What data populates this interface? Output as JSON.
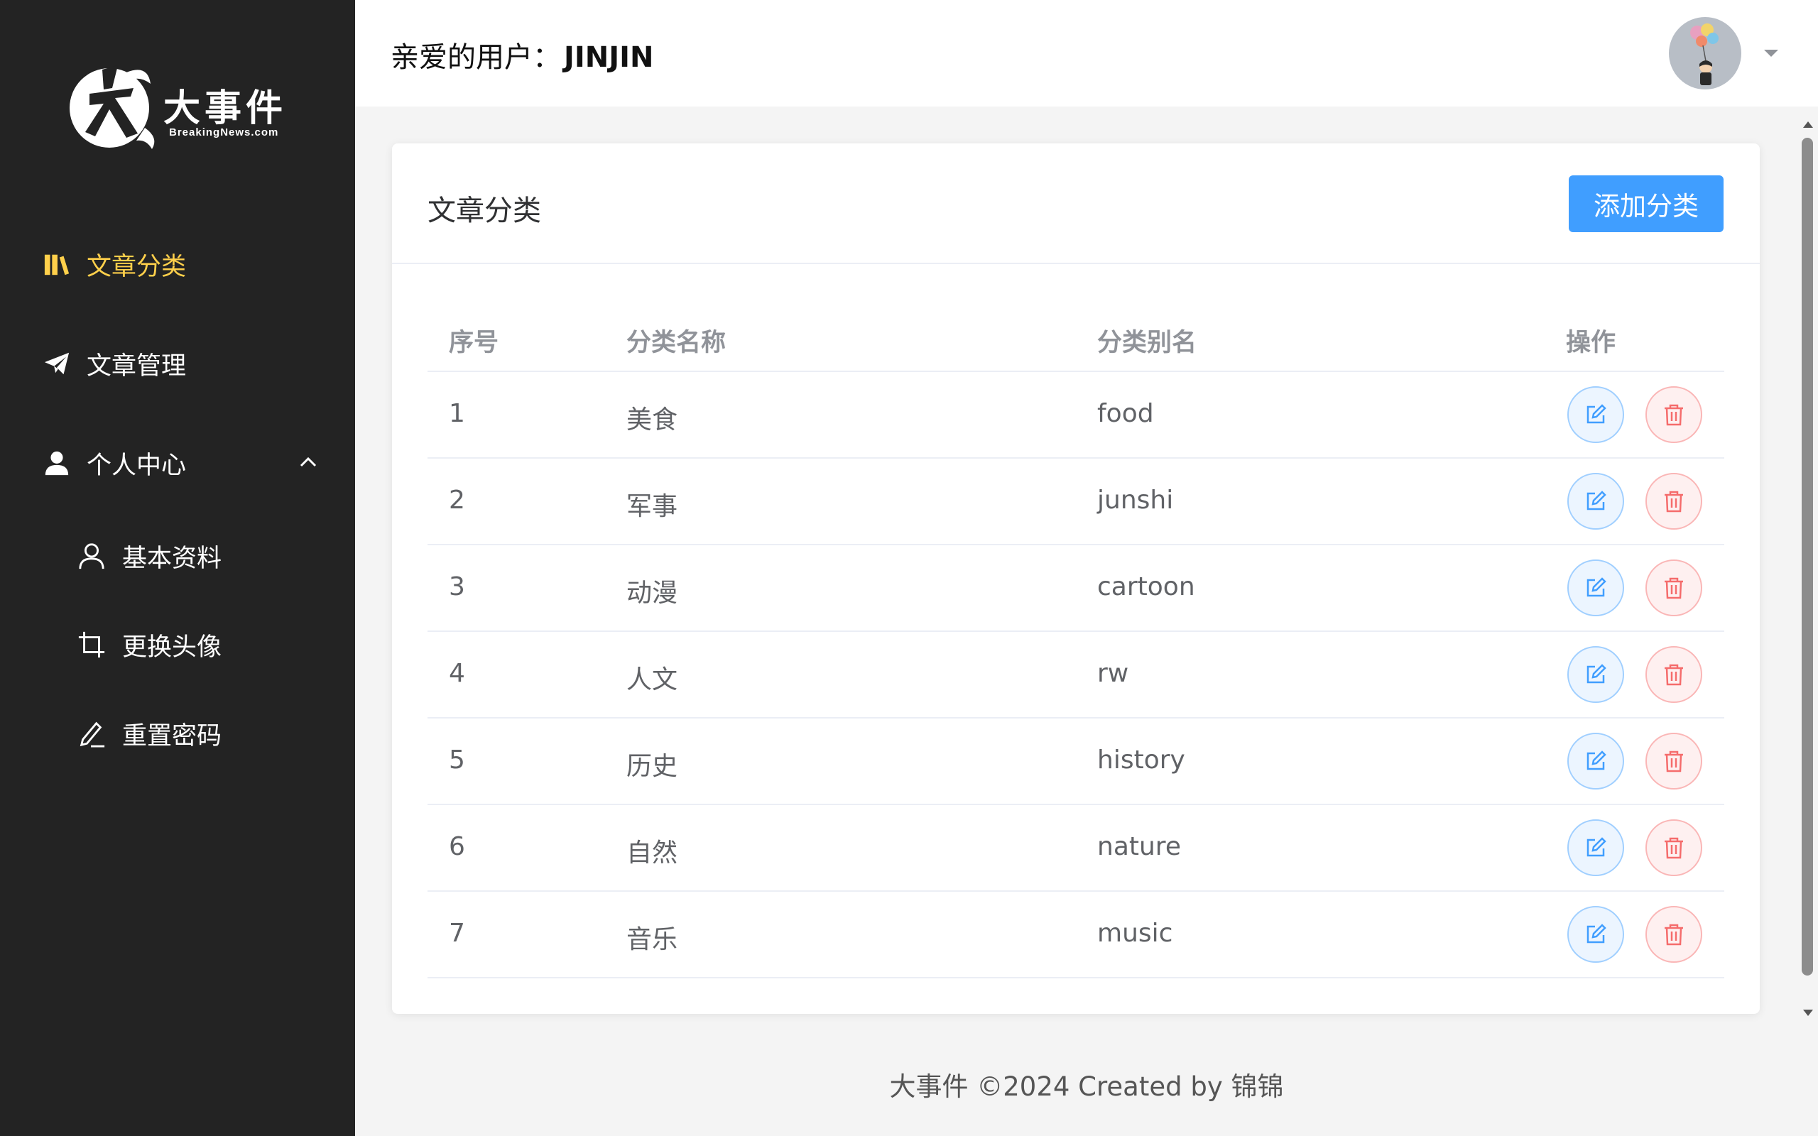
{
  "brand": {
    "name_cn": "大事件",
    "name_en": "BreakingNews.com"
  },
  "sidebar": {
    "items": [
      {
        "label": "文章分类",
        "icon": "bookshelf-icon",
        "active": true
      },
      {
        "label": "文章管理",
        "icon": "paper-plane-icon",
        "active": false
      },
      {
        "label": "个人中心",
        "icon": "user-icon",
        "expanded": true,
        "children": [
          {
            "label": "基本资料",
            "icon": "user-outline-icon"
          },
          {
            "label": "更换头像",
            "icon": "crop-icon"
          },
          {
            "label": "重置密码",
            "icon": "edit-pen-icon"
          }
        ]
      }
    ],
    "active_color": "#ffd04b",
    "background": "#232323"
  },
  "header": {
    "greeting_prefix": "亲爱的用户：",
    "username": "JINJIN"
  },
  "card": {
    "title": "文章分类",
    "add_button": "添加分类"
  },
  "table": {
    "columns": [
      "序号",
      "分类名称",
      "分类别名",
      "操作"
    ],
    "rows": [
      {
        "index": "1",
        "name": "美食",
        "alias": "food"
      },
      {
        "index": "2",
        "name": "军事",
        "alias": "junshi"
      },
      {
        "index": "3",
        "name": "动漫",
        "alias": "cartoon"
      },
      {
        "index": "4",
        "name": "人文",
        "alias": "rw"
      },
      {
        "index": "5",
        "name": "历史",
        "alias": "history"
      },
      {
        "index": "6",
        "name": "自然",
        "alias": "nature"
      },
      {
        "index": "7",
        "name": "音乐",
        "alias": "music"
      }
    ]
  },
  "footer": {
    "text": "大事件 ©2024 Created by 锦锦"
  },
  "colors": {
    "primary": "#409eff",
    "danger": "#f56c6c"
  }
}
